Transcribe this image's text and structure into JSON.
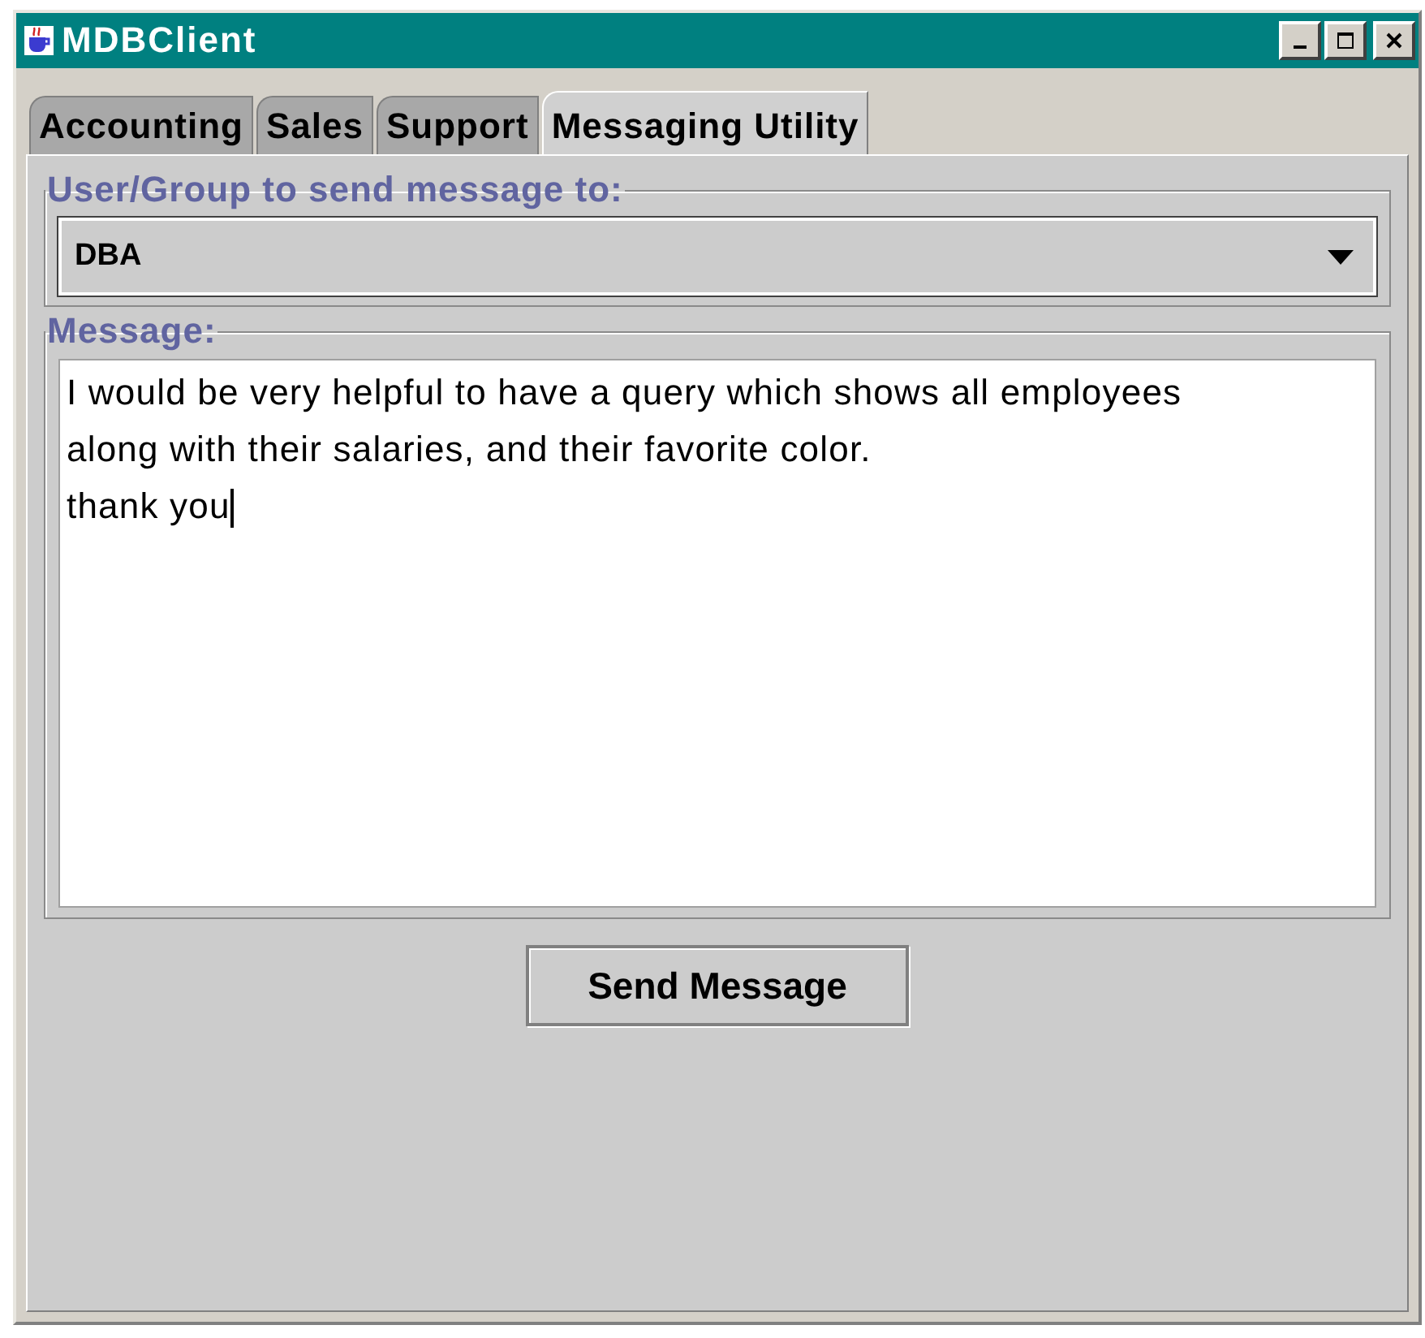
{
  "window": {
    "title": "MDBClient"
  },
  "tabs": [
    {
      "label": "Accounting",
      "selected": false
    },
    {
      "label": "Sales",
      "selected": false
    },
    {
      "label": "Support",
      "selected": false
    },
    {
      "label": "Messaging Utility",
      "selected": true
    }
  ],
  "recipient": {
    "label": "User/Group to send message to:",
    "value": "DBA"
  },
  "message": {
    "label": "Message:",
    "lines": [
      "I would be very helpful to have a query which shows all employees",
      "along with their salaries, and their favorite color.",
      "thank you"
    ]
  },
  "send_button": "Send Message"
}
